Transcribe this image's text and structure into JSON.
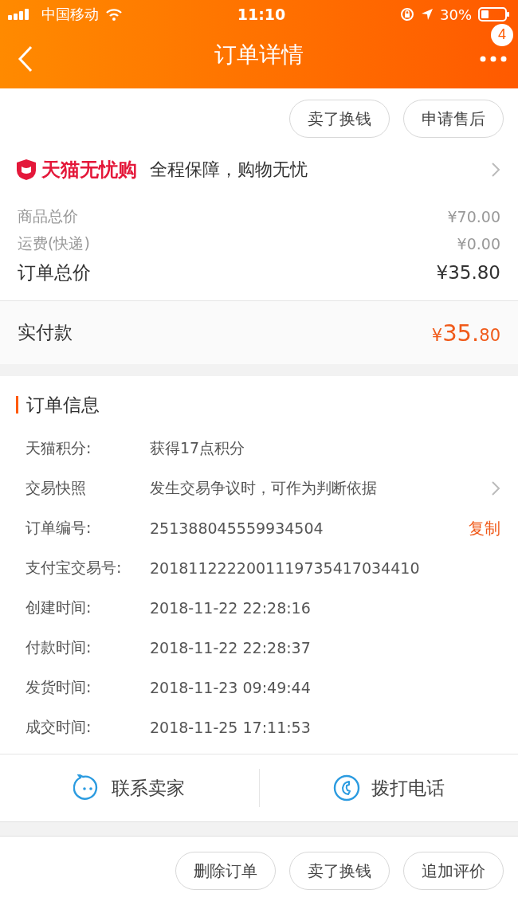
{
  "status_bar": {
    "carrier": "中国移动",
    "time": "11:10",
    "battery": "30%"
  },
  "nav": {
    "title": "订单详情",
    "badge": "4"
  },
  "top_actions": [
    "卖了换钱",
    "申请售后"
  ],
  "guarantee": {
    "brand": "天猫无忧购",
    "text": "全程保障，购物无忧"
  },
  "prices": [
    {
      "label": "商品总价",
      "value": "¥70.00",
      "kind": "minor"
    },
    {
      "label": "运费(快递)",
      "value": "¥0.00",
      "kind": "minor"
    },
    {
      "label": "订单总价",
      "value": "¥35.80",
      "kind": "total"
    }
  ],
  "paid": {
    "label": "实付款",
    "currency": "¥",
    "integer": "35.",
    "decimal": "80"
  },
  "order_info": {
    "title": "订单信息",
    "rows": [
      {
        "label": "天猫积分:",
        "value": "获得17点积分",
        "kind": "plain"
      },
      {
        "label": "交易快照",
        "value": "发生交易争议时，可作为判断依据",
        "kind": "link"
      },
      {
        "label": "订单编号:",
        "value": "251388045559934504",
        "kind": "copy",
        "action": "复制"
      },
      {
        "label": "支付宝交易号:",
        "value": "2018112222001119735417034410",
        "kind": "plain"
      },
      {
        "label": "创建时间:",
        "value": "2018-11-22 22:28:16",
        "kind": "plain"
      },
      {
        "label": "付款时间:",
        "value": "2018-11-22 22:28:37",
        "kind": "plain"
      },
      {
        "label": "发货时间:",
        "value": "2018-11-23 09:49:44",
        "kind": "plain"
      },
      {
        "label": "成交时间:",
        "value": "2018-11-25 17:11:53",
        "kind": "plain"
      }
    ]
  },
  "contact": [
    {
      "label": "联系卖家",
      "kind": "chat"
    },
    {
      "label": "拨打电话",
      "kind": "phone"
    }
  ],
  "bottom_actions": [
    "删除订单",
    "卖了换钱",
    "追加评价"
  ]
}
